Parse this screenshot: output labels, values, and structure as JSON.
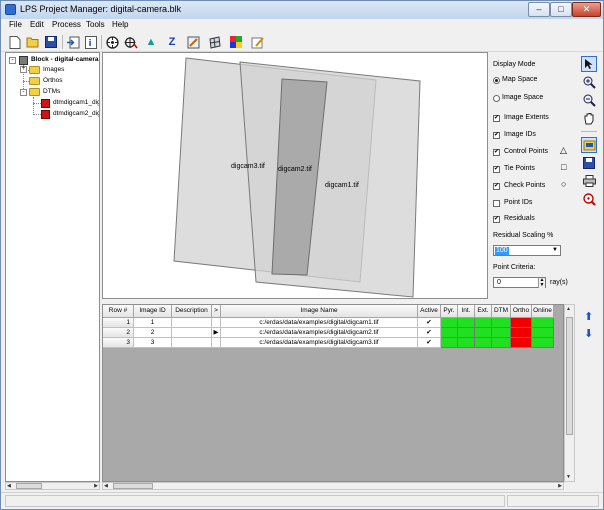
{
  "window": {
    "title": "LPS Project Manager: digital-camera.blk",
    "min": "–",
    "max": "□",
    "close": "✕"
  },
  "menu": [
    "File",
    "Edit",
    "Process",
    "Tools",
    "Help"
  ],
  "toolbar": [
    "new-icon",
    "open-icon",
    "save-icon",
    "import-icon",
    "info-icon",
    "frame-editor-icon",
    "point-measure-icon",
    "triangulate-icon",
    "z-icon",
    "edit-icon",
    "ortho-icon",
    "mosaic-icon",
    "pen-icon"
  ],
  "toolbar_glyphs": {
    "z": "Z",
    "triangle": "▲"
  },
  "tree": {
    "root": "Block - digital-camera",
    "images": "Images",
    "orthos": "Orthos",
    "dtms": "DTMs",
    "dtm1": "dtmdigcam1_dig",
    "dtm2": "dtmdigcam2_dig",
    "expand_plus": "+",
    "expand_minus": "-"
  },
  "canvas": {
    "labels": [
      "digcam3.tif",
      "digcam2.tif",
      "digcam1.tif"
    ],
    "colors": {
      "frame_fill": "#d2d2d2",
      "frame_stroke": "#7a7a7a",
      "overlap": "#a8a8a8"
    }
  },
  "options": {
    "display_mode": "Display Mode",
    "map_space": "Map Space",
    "image_space": "Image Space",
    "image_extents": "Image Extents",
    "image_ids": "Image IDs",
    "control_points": "Control Points",
    "tie_points": "Tie Points",
    "check_points": "Check Points",
    "point_ids": "Point IDs",
    "residuals": "Residuals",
    "residual_scaling": "Residual Scaling %",
    "residual_value": "100",
    "point_criteria": "Point Criteria:",
    "point_value": "0",
    "rays_unit": "ray(s)",
    "check": "✔",
    "triangle": "△",
    "square": "□",
    "circle": "○",
    "combo_arrow": "▼",
    "spin_up": "▲",
    "spin_down": "▼"
  },
  "vertical_tools": [
    "select-icon",
    "zoom-in-icon",
    "zoom-out-icon",
    "pan-icon",
    "edit-block-icon",
    "save-view-icon",
    "print-icon",
    "measure-icon"
  ],
  "table": {
    "columns": [
      "Row #",
      "Image ID",
      "Description",
      ">",
      "Image Name",
      "Active",
      "Pyr.",
      "Int.",
      "Ext.",
      "DTM",
      "Ortho",
      "Online"
    ],
    "rows": [
      {
        "row": "1",
        "id": "1",
        "desc": "",
        "marker": "",
        "name": "c:/erdas/data/examples/digital/digcam1.tif",
        "active": "✔"
      },
      {
        "row": "2",
        "id": "2",
        "desc": "",
        "marker": "▶",
        "name": "c:/erdas/data/examples/digital/digcam2.tif",
        "active": "✔"
      },
      {
        "row": "3",
        "id": "3",
        "desc": "",
        "marker": "",
        "name": "c:/erdas/data/examples/digital/digcam3.tif",
        "active": "✔"
      }
    ],
    "status_colors": {
      "green": "#21e021",
      "red": "#f00000"
    },
    "status": [
      [
        "green",
        "green",
        "green",
        "green",
        "red",
        "green"
      ],
      [
        "green",
        "green",
        "green",
        "green",
        "red",
        "green"
      ],
      [
        "green",
        "green",
        "green",
        "green",
        "red",
        "green"
      ]
    ]
  },
  "scroll": {
    "left": "◀",
    "right": "▶",
    "up": "▲",
    "down": "▼"
  },
  "nav": {
    "up": "⬆",
    "down": "⬇"
  }
}
